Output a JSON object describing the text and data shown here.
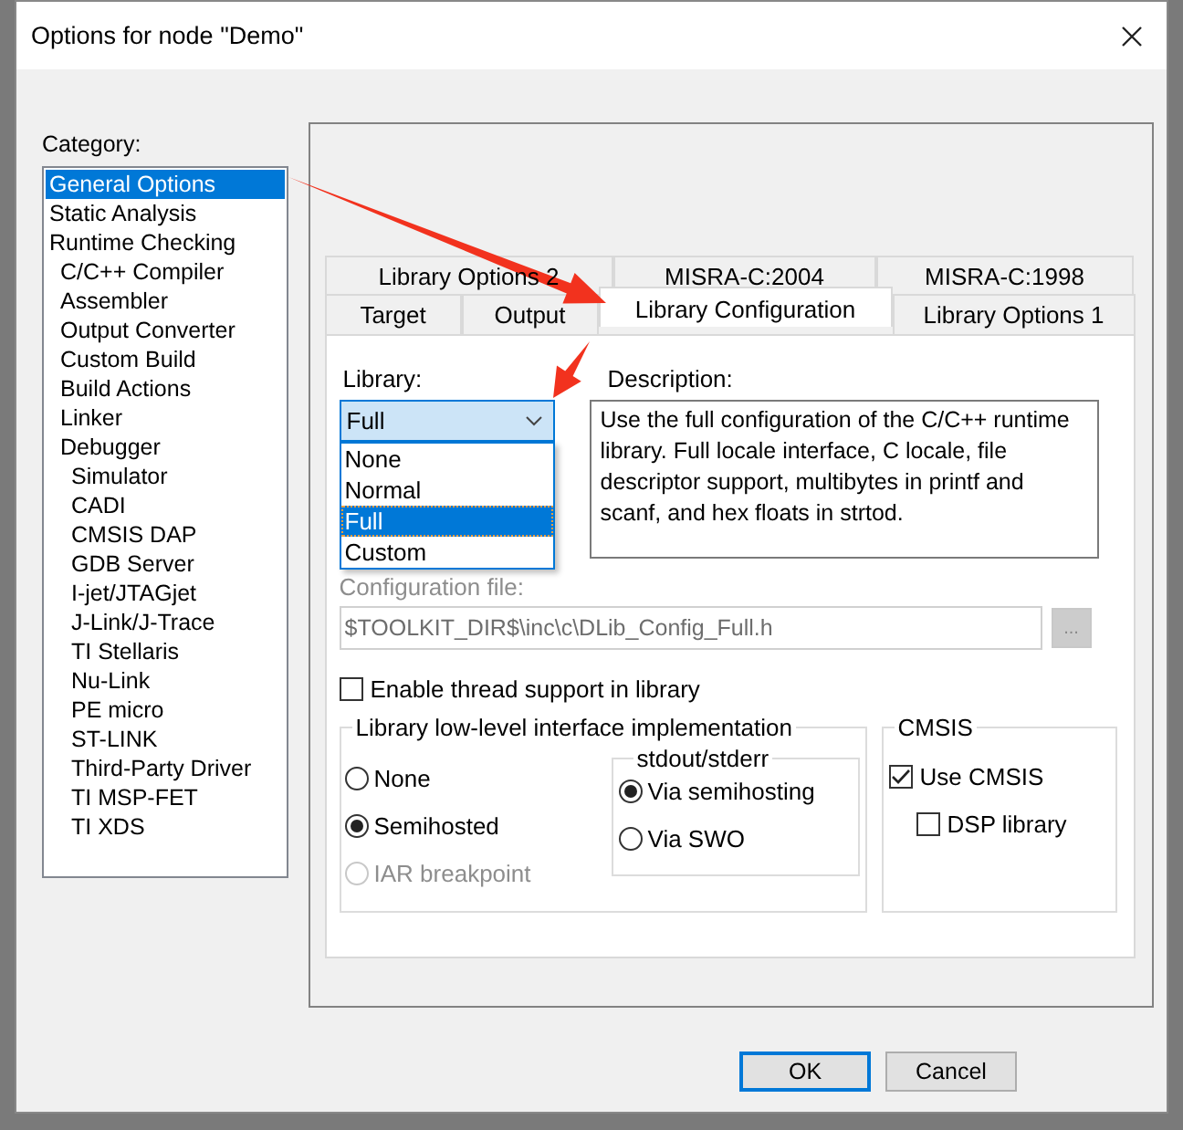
{
  "window": {
    "title": "Options for node \"Demo\""
  },
  "category": {
    "label": "Category:",
    "items": [
      {
        "label": "General Options",
        "kind": "general",
        "selected": true
      },
      {
        "label": "Static Analysis",
        "kind": "general",
        "selected": false
      },
      {
        "label": "Runtime Checking",
        "kind": "general",
        "selected": false
      },
      {
        "label": "C/C++ Compiler",
        "kind": "tool",
        "selected": false
      },
      {
        "label": "Assembler",
        "kind": "tool",
        "selected": false
      },
      {
        "label": "Output Converter",
        "kind": "tool",
        "selected": false
      },
      {
        "label": "Custom Build",
        "kind": "tool",
        "selected": false
      },
      {
        "label": "Build Actions",
        "kind": "tool",
        "selected": false
      },
      {
        "label": "Linker",
        "kind": "tool",
        "selected": false
      },
      {
        "label": "Debugger",
        "kind": "tool",
        "selected": false,
        "children": [
          {
            "label": "Simulator",
            "selected": false
          },
          {
            "label": "CADI",
            "selected": false
          },
          {
            "label": "CMSIS DAP",
            "selected": false
          },
          {
            "label": "GDB Server",
            "selected": false
          },
          {
            "label": "I-jet/JTAGjet",
            "selected": false
          },
          {
            "label": "J-Link/J-Trace",
            "selected": false
          },
          {
            "label": "TI Stellaris",
            "selected": false
          },
          {
            "label": "Nu-Link",
            "selected": false
          },
          {
            "label": "PE micro",
            "selected": false
          },
          {
            "label": "ST-LINK",
            "selected": false
          },
          {
            "label": "Third-Party Driver",
            "selected": false
          },
          {
            "label": "TI MSP-FET",
            "selected": false
          },
          {
            "label": "TI XDS",
            "selected": false
          }
        ]
      }
    ]
  },
  "tab_rows": [
    [
      {
        "label": "Library Options 2",
        "selected": false
      },
      {
        "label": "MISRA-C:2004",
        "selected": false
      },
      {
        "label": "MISRA-C:1998",
        "selected": false
      }
    ],
    [
      {
        "label": "Target",
        "selected": false
      },
      {
        "label": "Output",
        "selected": false
      },
      {
        "label": "Library Configuration",
        "selected": true
      },
      {
        "label": "Library Options 1",
        "selected": false
      }
    ]
  ],
  "library": {
    "label": "Library:",
    "value": "Full",
    "expanded": true,
    "options": [
      {
        "label": "None",
        "selected": false
      },
      {
        "label": "Normal",
        "selected": false
      },
      {
        "label": "Full",
        "selected": true
      },
      {
        "label": "Custom",
        "selected": false
      }
    ]
  },
  "description": {
    "label": "Description:",
    "text": "Use the full configuration of the C/C++ runtime library. Full locale interface, C locale, file descriptor support, multibytes in printf and scanf, and hex floats in strtod."
  },
  "config_file": {
    "label": "Configuration file:",
    "value": "$TOOLKIT_DIR$\\inc\\c\\DLib_Config_Full.h",
    "disabled": true,
    "browse": "..."
  },
  "thread_support": {
    "label": "Enable thread support in library",
    "checked": false
  },
  "low_level": {
    "title": "Library low-level interface implementation",
    "options": [
      {
        "label": "None",
        "selected": false,
        "disabled": false
      },
      {
        "label": "Semihosted",
        "selected": true,
        "disabled": false
      },
      {
        "label": "IAR breakpoint",
        "selected": false,
        "disabled": true
      }
    ],
    "stdout": {
      "title": "stdout/stderr",
      "options": [
        {
          "label": "Via semihosting",
          "selected": true
        },
        {
          "label": "Via SWO",
          "selected": false
        }
      ]
    }
  },
  "cmsis": {
    "title": "CMSIS",
    "items": [
      {
        "label": "Use CMSIS",
        "kind": "main",
        "checked": true
      },
      {
        "label": "DSP library",
        "kind": "sub",
        "checked": false
      }
    ]
  },
  "buttons": [
    {
      "label": "OK",
      "focused": true
    },
    {
      "label": "Cancel",
      "focused": false
    }
  ]
}
